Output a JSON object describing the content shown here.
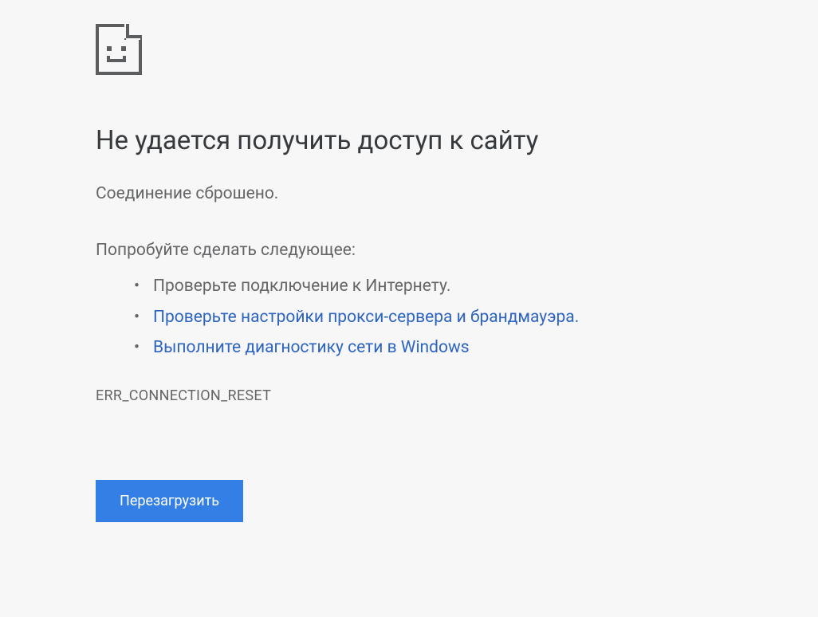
{
  "error": {
    "title": "Не удается получить доступ к сайту",
    "subtitle": "Соединение сброшено.",
    "suggestions_label": "Попробуйте сделать следующее:",
    "suggestions": [
      {
        "text": "Проверьте подключение к Интернету.",
        "is_link": false
      },
      {
        "text": "Проверьте настройки прокси-сервера и брандмауэра.",
        "is_link": true
      },
      {
        "text": "Выполните диагностику сети в Windows",
        "is_link": true
      }
    ],
    "code": "ERR_CONNECTION_RESET",
    "reload_button": "Перезагрузить"
  }
}
